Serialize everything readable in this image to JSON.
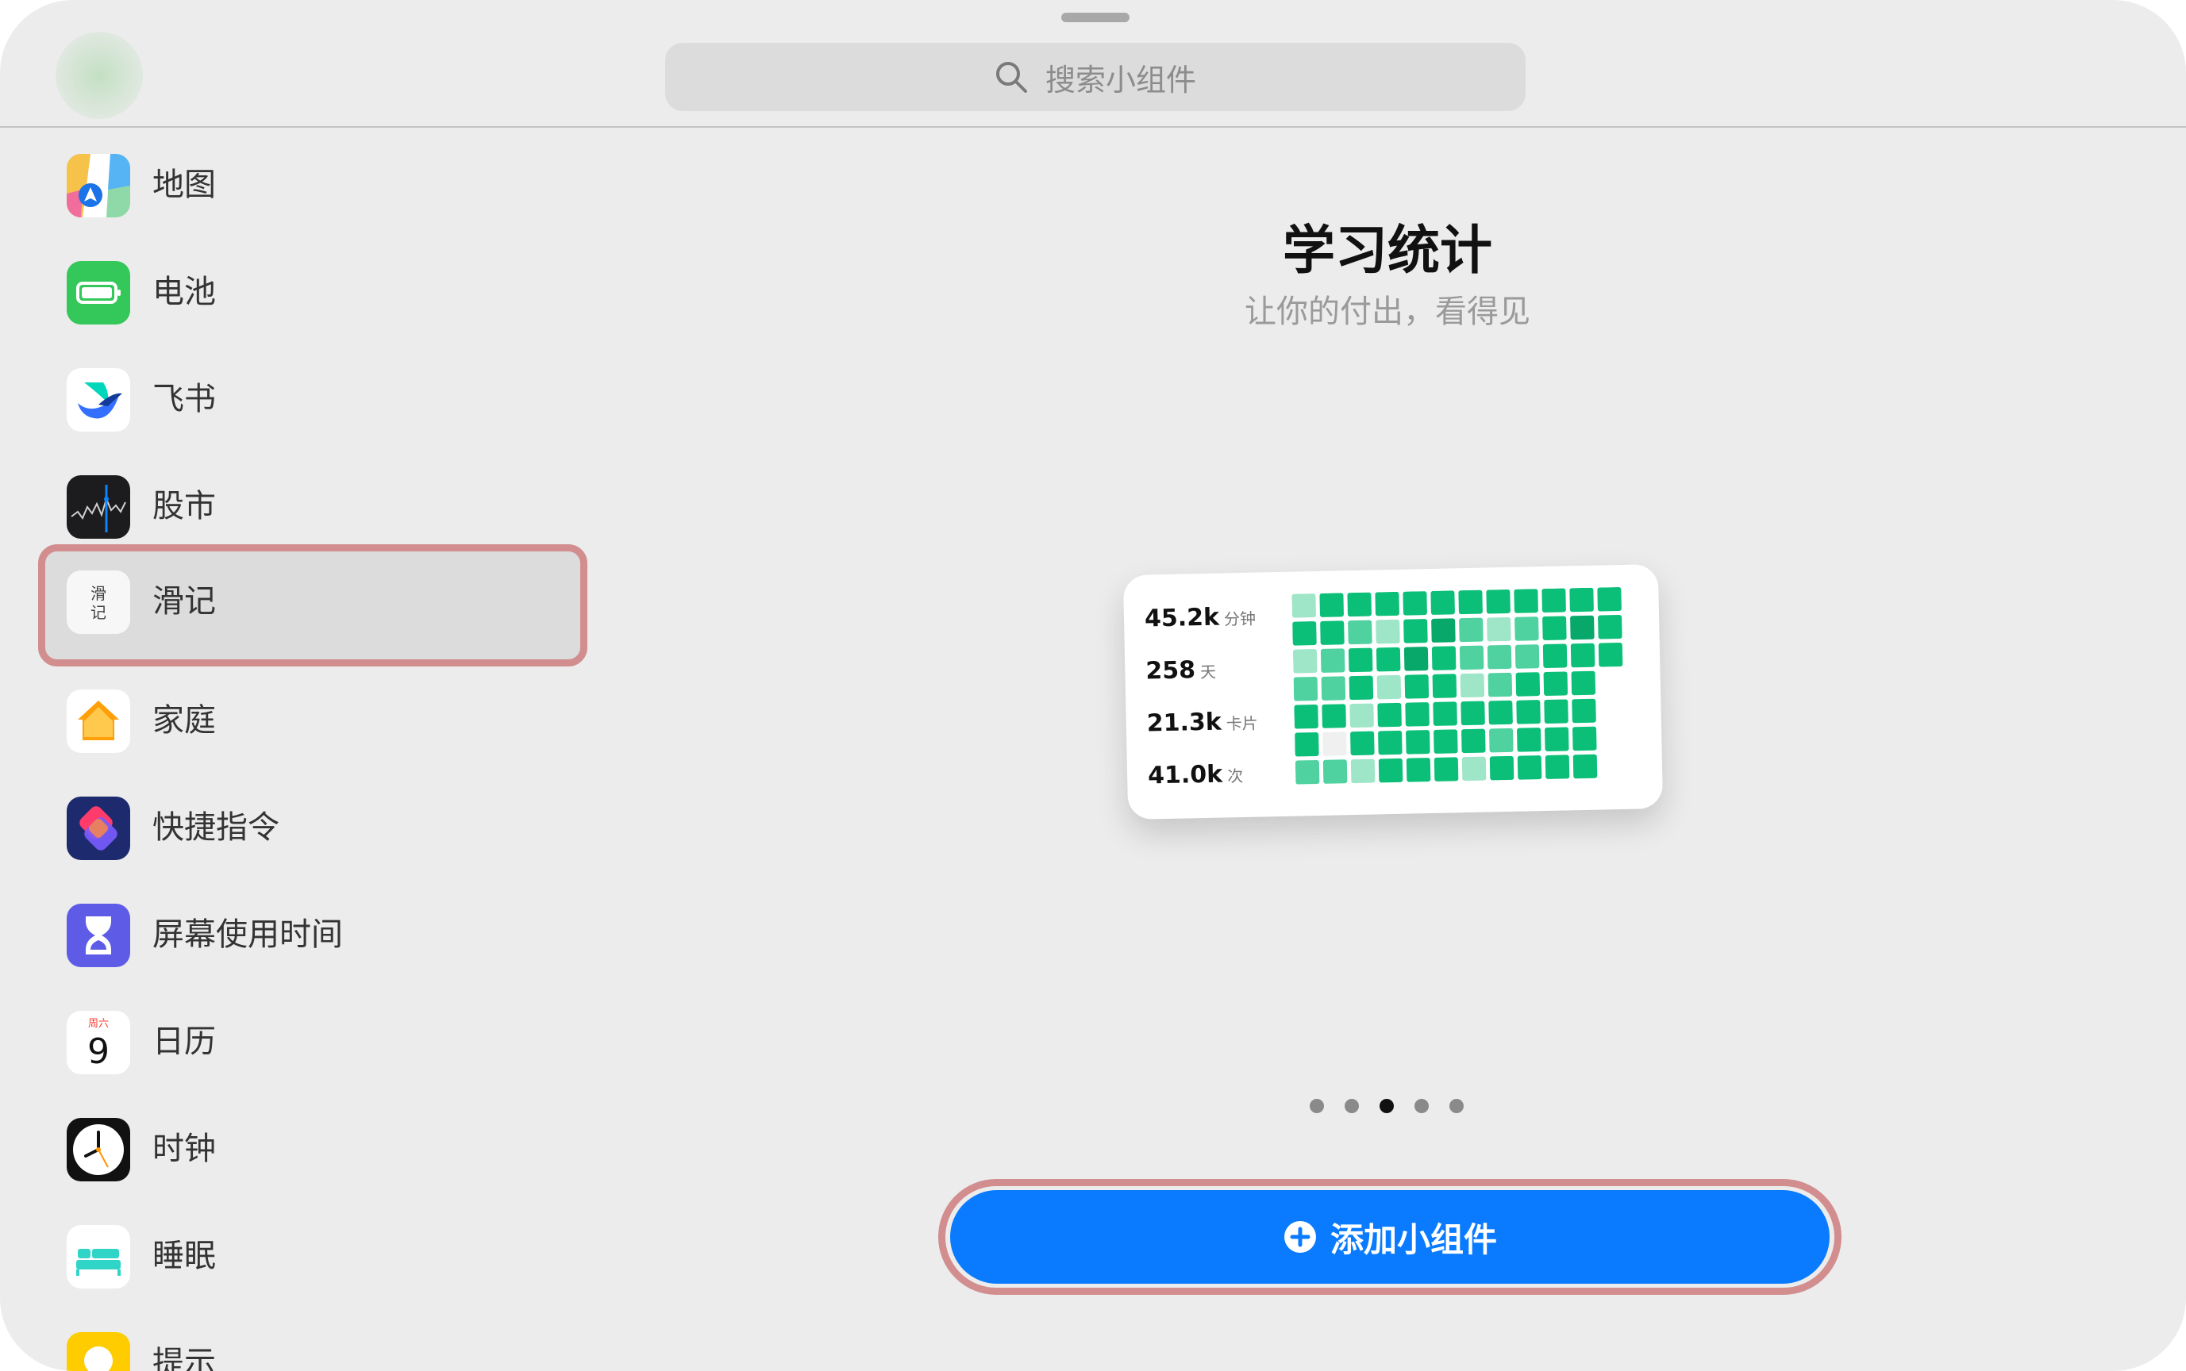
{
  "search": {
    "placeholder": "搜索小组件"
  },
  "sidebar": {
    "items": [
      {
        "label": "地图",
        "icon": "maps-icon"
      },
      {
        "label": "电池",
        "icon": "battery-icon"
      },
      {
        "label": "飞书",
        "icon": "feishu-icon"
      },
      {
        "label": "股市",
        "icon": "stocks-icon"
      },
      {
        "label": "滑记",
        "icon": "huaji-icon",
        "icon_text_line1": "滑",
        "icon_text_line2": "记",
        "selected": true
      },
      {
        "label": "家庭",
        "icon": "home-icon"
      },
      {
        "label": "快捷指令",
        "icon": "shortcuts-icon"
      },
      {
        "label": "屏幕使用时间",
        "icon": "screen-time-icon"
      },
      {
        "label": "日历",
        "icon": "calendar-icon",
        "icon_weekday": "周六",
        "icon_day": "9"
      },
      {
        "label": "时钟",
        "icon": "clock-icon"
      },
      {
        "label": "睡眠",
        "icon": "sleep-icon"
      },
      {
        "label": "提示",
        "icon": "tips-icon"
      }
    ]
  },
  "widget_preview": {
    "title": "学习统计",
    "subtitle": "让你的付出，看得见",
    "stats": [
      {
        "value": "45.2k",
        "unit": "分钟"
      },
      {
        "value": "258",
        "unit": "天"
      },
      {
        "value": "21.3k",
        "unit": "卡片"
      },
      {
        "value": "41.0k",
        "unit": "次"
      }
    ],
    "heatmap": {
      "rows": 7,
      "cols": 12,
      "levels": [
        [
          1,
          3,
          3,
          3,
          3,
          3,
          3,
          3,
          3,
          3,
          3,
          3
        ],
        [
          3,
          3,
          2,
          1,
          3,
          4,
          2,
          1,
          2,
          3,
          4,
          3
        ],
        [
          1,
          2,
          3,
          3,
          4,
          3,
          2,
          2,
          2,
          3,
          3,
          3
        ],
        [
          2,
          2,
          3,
          1,
          3,
          3,
          1,
          2,
          3,
          3,
          3,
          0
        ],
        [
          3,
          3,
          1,
          3,
          3,
          3,
          3,
          3,
          3,
          3,
          3,
          0
        ],
        [
          3,
          0,
          3,
          3,
          3,
          3,
          3,
          2,
          3,
          3,
          3,
          0
        ],
        [
          2,
          2,
          1,
          3,
          3,
          3,
          1,
          3,
          3,
          3,
          3,
          0
        ]
      ],
      "colors": [
        "#f0f0f0",
        "#9fe6c8",
        "#4fd2a0",
        "#0cbf78",
        "#08a86a"
      ]
    }
  },
  "pager": {
    "count": 5,
    "active_index": 2
  },
  "add_button": {
    "label": "添加小组件"
  },
  "colors": {
    "accent": "#0a7bff",
    "highlight": "#d28e8e",
    "background": "#ececec"
  }
}
